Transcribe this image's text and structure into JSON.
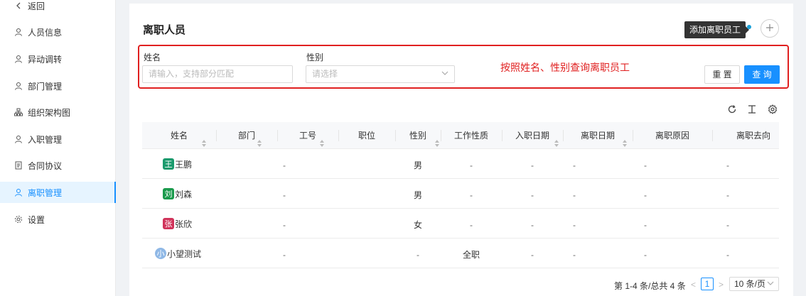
{
  "sidebar": {
    "back": "返回",
    "items": [
      {
        "label": "人员信息"
      },
      {
        "label": "异动调转"
      },
      {
        "label": "部门管理"
      },
      {
        "label": "组织架构图"
      },
      {
        "label": "入职管理"
      },
      {
        "label": "合同协议"
      },
      {
        "label": "离职管理"
      },
      {
        "label": "设置"
      }
    ]
  },
  "header": {
    "title": "离职人员",
    "tooltip": "添加离职员工",
    "add_icon": "plus-icon"
  },
  "filter": {
    "name_label": "姓名",
    "name_placeholder": "请输入，支持部分匹配",
    "gender_label": "性别",
    "gender_placeholder": "请选择",
    "annotation": "按照姓名、性别查询离职员工",
    "reset_label": "重 置",
    "query_label": "查 询",
    "highlight_color": "#e02020"
  },
  "toolbar": {
    "icons": [
      "refresh-icon",
      "column-height-icon",
      "settings-icon"
    ]
  },
  "table": {
    "columns": [
      "姓名",
      "部门",
      "工号",
      "职位",
      "性别",
      "工作性质",
      "入职日期",
      "离职日期",
      "离职原因",
      "离职去向"
    ],
    "rows": [
      {
        "avatar": "王",
        "avatar_color": "#1a9a6c",
        "name": "王鹏",
        "dept": "-",
        "no": "",
        "position": "",
        "gender": "男",
        "nature": "-",
        "join": "-",
        "leave": "-",
        "reason": "-",
        "dest": "-"
      },
      {
        "avatar": "刘",
        "avatar_color": "#1a9a4c",
        "name": "刘森",
        "dept": "-",
        "no": "",
        "position": "",
        "gender": "男",
        "nature": "-",
        "join": "-",
        "leave": "-",
        "reason": "-",
        "dest": "-"
      },
      {
        "avatar": "张",
        "avatar_color": "#d0335a",
        "name": "张欣",
        "dept": "-",
        "no": "",
        "position": "",
        "gender": "女",
        "nature": "-",
        "join": "-",
        "leave": "-",
        "reason": "-",
        "dest": "-"
      },
      {
        "avatar": "小",
        "avatar_color": "#8fb8e6",
        "name": "小望测试",
        "dept": "-",
        "no": "",
        "position": "",
        "gender": "-",
        "nature": "全职",
        "join": "-",
        "leave": "-",
        "reason": "-",
        "dest": "-"
      }
    ]
  },
  "pagination": {
    "total": "第 1-4 条/总共 4 条",
    "current_page": "1",
    "page_size": "10 条/页",
    "prev": "<",
    "next": ">"
  },
  "colors": {
    "accent": "#1890ff",
    "active_bg": "#e6f4ff"
  }
}
